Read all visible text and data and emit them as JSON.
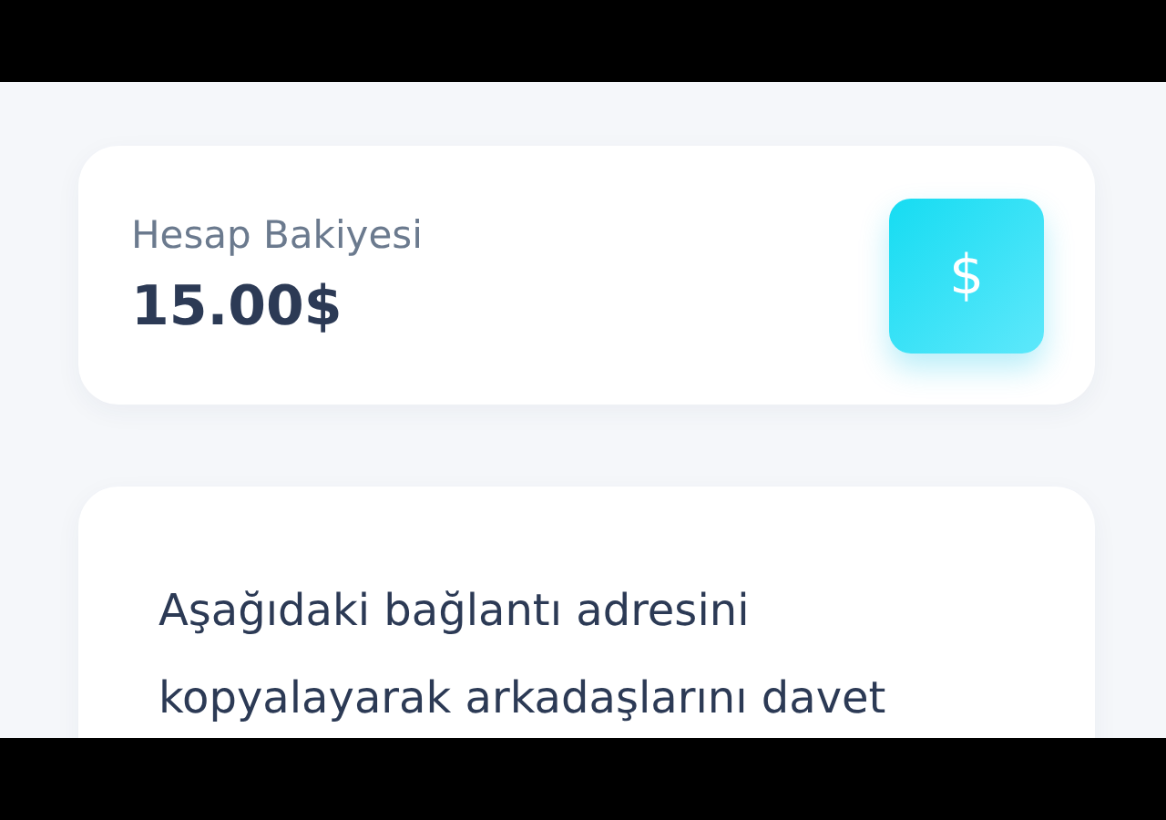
{
  "balance_card": {
    "label": "Hesap Bakiyesi",
    "amount": "15.00$",
    "icon_glyph": "$"
  },
  "invite_card": {
    "text": "Aşağıdaki bağlantı adresini kopyalayarak arkadaşlarını davet"
  }
}
